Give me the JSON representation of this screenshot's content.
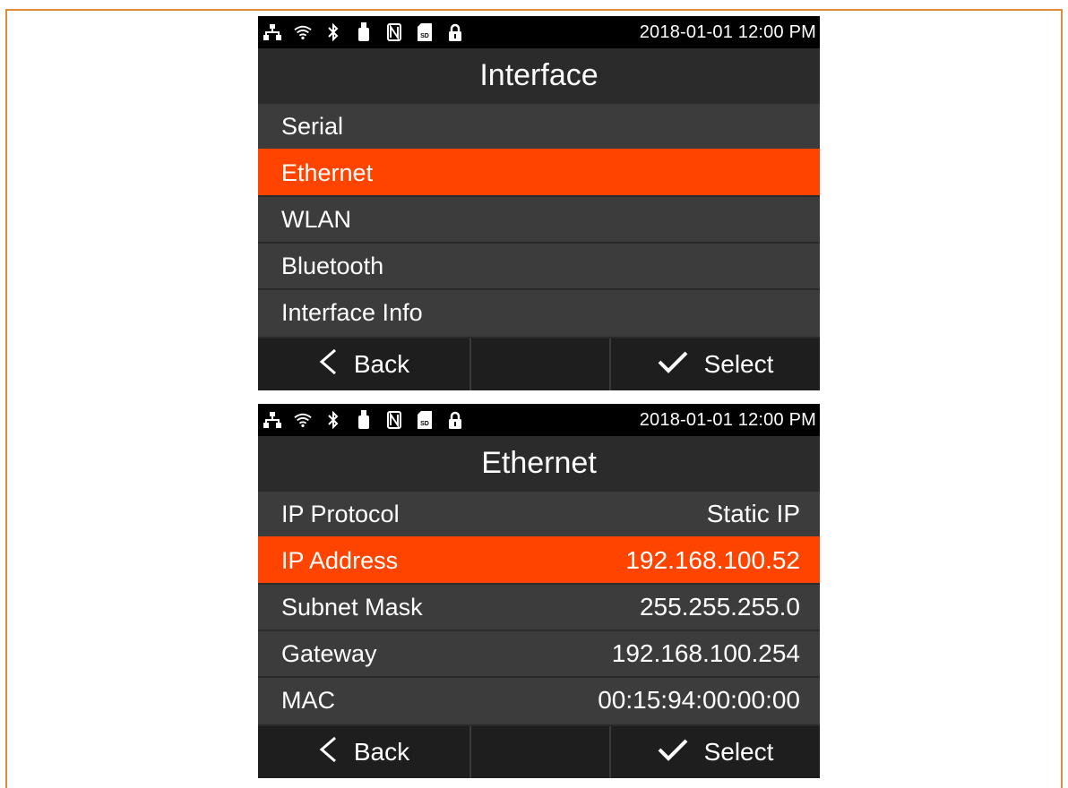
{
  "status_bar": {
    "icons": [
      "ethernet-icon",
      "wifi-icon",
      "bluetooth-icon",
      "usb-icon",
      "nfc-icon",
      "sd-card-icon",
      "lock-icon"
    ],
    "datetime": "2018-01-01 12:00 PM"
  },
  "screens": [
    {
      "title": "Interface",
      "items": [
        {
          "label": "Serial",
          "value": ""
        },
        {
          "label": "Ethernet",
          "value": "",
          "selected": true
        },
        {
          "label": "WLAN",
          "value": ""
        },
        {
          "label": "Bluetooth",
          "value": ""
        },
        {
          "label": "Interface Info",
          "value": ""
        }
      ],
      "softkeys": {
        "back": "Back",
        "select": "Select"
      }
    },
    {
      "title": "Ethernet",
      "items": [
        {
          "label": "IP Protocol",
          "value": "Static IP"
        },
        {
          "label": "IP Address",
          "value": "192.168.100.52",
          "selected": true
        },
        {
          "label": "Subnet Mask",
          "value": "255.255.255.0"
        },
        {
          "label": "Gateway",
          "value": "192.168.100.254"
        },
        {
          "label": "MAC",
          "value": "00:15:94:00:00:00"
        }
      ],
      "softkeys": {
        "back": "Back",
        "select": "Select"
      }
    }
  ],
  "colors": {
    "accent": "#ff4400",
    "frame": "#e08b3c"
  }
}
